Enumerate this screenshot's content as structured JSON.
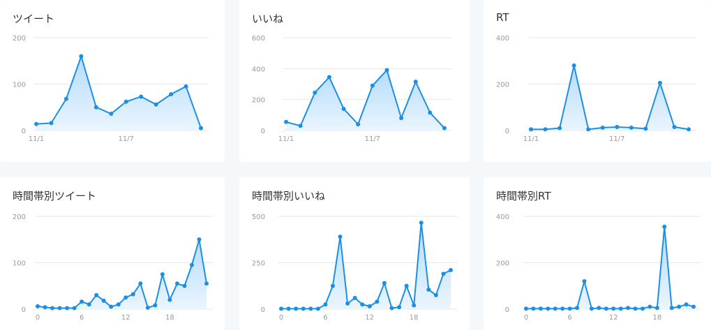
{
  "colors": {
    "line": "#1b8fe6",
    "fill_top": "#a9d6fb",
    "fill_bottom": "#e8f4fe",
    "grid": "#e6e6e6",
    "tick": "#999999"
  },
  "chart_data": [
    {
      "type": "area",
      "title": "ツイート",
      "x_tick_labels": [
        "11/1",
        "11/7"
      ],
      "x_tick_indices": [
        0,
        6
      ],
      "y_ticks": [
        "200",
        "100",
        "0"
      ],
      "ylim": [
        0,
        200
      ],
      "values": [
        14,
        16,
        68,
        160,
        50,
        36,
        62,
        73,
        56,
        78,
        95,
        5
      ]
    },
    {
      "type": "area",
      "title": "いいね",
      "x_tick_labels": [
        "11/1",
        "11/7"
      ],
      "x_tick_indices": [
        0,
        6
      ],
      "y_ticks": [
        "600",
        "400",
        "200",
        "0"
      ],
      "ylim": [
        0,
        600
      ],
      "values": [
        55,
        30,
        245,
        345,
        140,
        40,
        290,
        390,
        80,
        315,
        115,
        15
      ]
    },
    {
      "type": "area",
      "title": "RT",
      "x_tick_labels": [
        "11/1",
        "11/7"
      ],
      "x_tick_indices": [
        0,
        6
      ],
      "y_ticks": [
        "400",
        "200",
        "0"
      ],
      "ylim": [
        0,
        400
      ],
      "values": [
        5,
        5,
        10,
        280,
        5,
        12,
        15,
        12,
        8,
        205,
        15,
        5
      ]
    },
    {
      "type": "area",
      "title": "時間帯別ツイート",
      "x_tick_labels": [
        "0",
        "6",
        "12",
        "18"
      ],
      "x_tick_indices": [
        0,
        6,
        12,
        18
      ],
      "y_ticks": [
        "200",
        "100",
        "0"
      ],
      "ylim": [
        0,
        200
      ],
      "values": [
        6,
        4,
        2,
        2,
        2,
        2,
        16,
        10,
        30,
        18,
        5,
        10,
        25,
        32,
        55,
        3,
        8,
        75,
        20,
        55,
        50,
        95,
        150,
        55
      ]
    },
    {
      "type": "area",
      "title": "時間帯別いいね",
      "x_tick_labels": [
        "0",
        "6",
        "12",
        "18"
      ],
      "x_tick_indices": [
        0,
        6,
        12,
        18
      ],
      "y_ticks": [
        "500",
        "250",
        "0"
      ],
      "ylim": [
        0,
        500
      ],
      "values": [
        2,
        2,
        2,
        2,
        2,
        2,
        25,
        125,
        390,
        30,
        60,
        25,
        15,
        40,
        140,
        5,
        10,
        125,
        20,
        465,
        105,
        75,
        190,
        210
      ]
    },
    {
      "type": "area",
      "title": "時間帯別RT",
      "x_tick_labels": [
        "0",
        "6",
        "12",
        "18"
      ],
      "x_tick_indices": [
        0,
        6,
        12,
        18
      ],
      "y_ticks": [
        "400",
        "200",
        "0"
      ],
      "ylim": [
        0,
        400
      ],
      "values": [
        2,
        2,
        2,
        2,
        2,
        2,
        2,
        5,
        120,
        2,
        5,
        2,
        2,
        2,
        5,
        2,
        2,
        10,
        5,
        355,
        5,
        10,
        20,
        10
      ]
    }
  ]
}
